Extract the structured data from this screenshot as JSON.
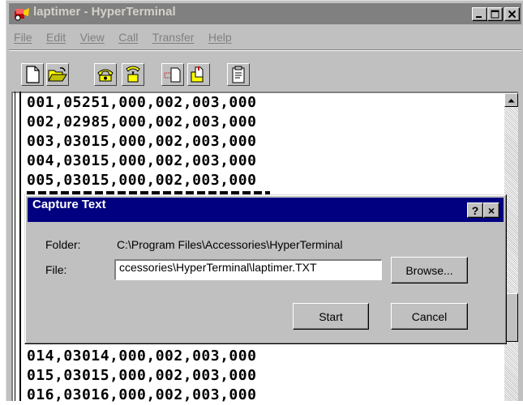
{
  "window": {
    "title": "laptimer - HyperTerminal",
    "menu": [
      {
        "label": "File"
      },
      {
        "label": "Edit"
      },
      {
        "label": "View"
      },
      {
        "label": "Call"
      },
      {
        "label": "Transfer"
      },
      {
        "label": "Help"
      }
    ],
    "toolbar_icons": [
      "new-icon",
      "open-icon",
      "connect-icon",
      "disconnect-icon",
      "send-icon",
      "receive-icon",
      "properties-icon"
    ]
  },
  "terminal": {
    "lines_top": [
      "001,05251,000,002,003,000",
      "002,02985,000,002,003,000",
      "003,03015,000,002,003,000",
      "004,03015,000,002,003,000",
      "005,03015,000,002,003,000"
    ],
    "lines_bottom": [
      "014,03014,000,002,003,000",
      "015,03015,000,002,003,000",
      "016,03016,000,002,003,000"
    ]
  },
  "dialog": {
    "title": "Capture Text",
    "help_label": "?",
    "close_label": "×",
    "folder_label": "Folder:",
    "folder_value": "C:\\Program Files\\Accessories\\HyperTerminal",
    "file_label": "File:",
    "file_value": "ccessories\\HyperTerminal\\laptimer.TXT",
    "browse_label": "Browse...",
    "start_label": "Start",
    "cancel_label": "Cancel"
  },
  "colors": {
    "title_inactive": "#808080",
    "dialog_title_active": "#000080",
    "face": "#c0c0c0"
  }
}
